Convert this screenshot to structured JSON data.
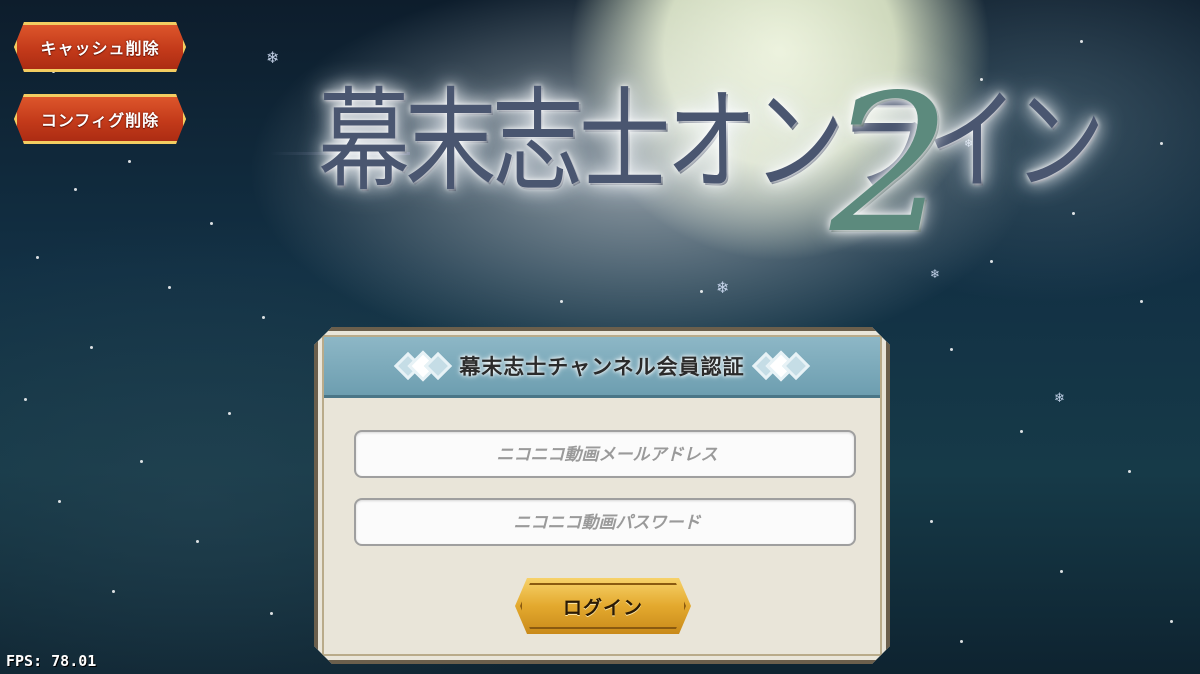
{
  "side_buttons": {
    "cache_clear": "キャッシュ削除",
    "config_clear": "コンフィグ削除"
  },
  "logo": {
    "title": "幕末志士オンライン",
    "number": "2"
  },
  "login_panel": {
    "title": "幕末志士チャンネル会員認証",
    "email_placeholder": "ニコニコ動画メールアドレス",
    "password_placeholder": "ニコニコ動画パスワード",
    "login_label": "ログイン"
  },
  "fps": "FPS: 78.01",
  "colors": {
    "side_button": "#c33a1a",
    "login_button": "#e3a92e",
    "panel_header": "#7aa9ba",
    "panel_bg": "#e9e5d9"
  }
}
